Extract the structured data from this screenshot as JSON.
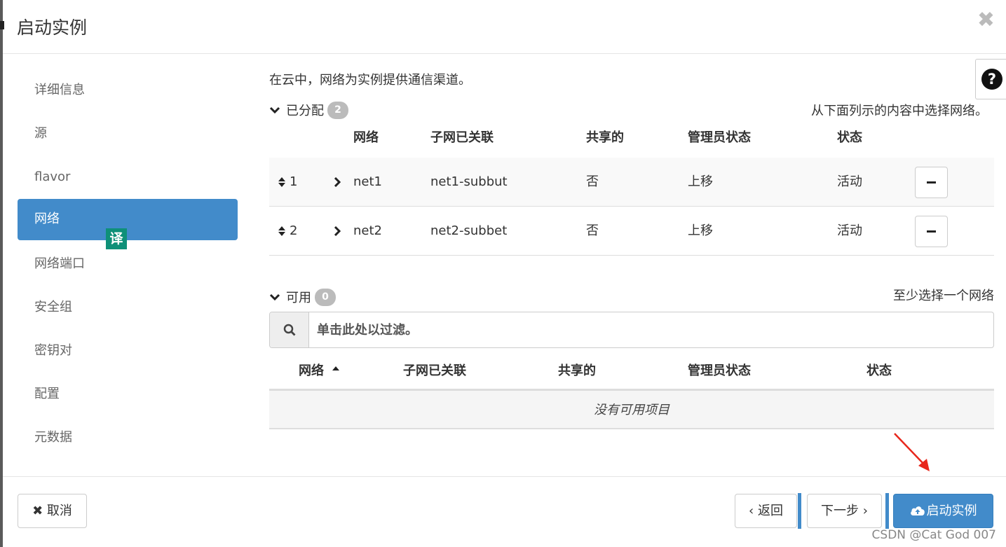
{
  "modal": {
    "title": "启动实例",
    "close_symbol": "✖",
    "help_symbol": "?"
  },
  "sidebar": {
    "items": [
      {
        "label": "详细信息"
      },
      {
        "label": "源"
      },
      {
        "label": "flavor"
      },
      {
        "label": "网络",
        "active": true
      },
      {
        "label": "网络端口"
      },
      {
        "label": "安全组"
      },
      {
        "label": "密钥对"
      },
      {
        "label": "配置"
      },
      {
        "label": "元数据"
      }
    ],
    "translate_badge": "译"
  },
  "main": {
    "intro": "在云中，网络为实例提供通信渠道。",
    "allocated": {
      "title": "已分配",
      "count": "2",
      "hint": "从下面列示的内容中选择网络。",
      "columns": [
        "网络",
        "子网已关联",
        "共享的",
        "管理员状态",
        "状态"
      ],
      "rows": [
        {
          "index": "1",
          "network": "net1",
          "subnet": "net1-subbut",
          "shared": "否",
          "admin_state": "上移",
          "status": "活动"
        },
        {
          "index": "2",
          "network": "net2",
          "subnet": "net2-subbet",
          "shared": "否",
          "admin_state": "上移",
          "status": "活动"
        }
      ]
    },
    "available": {
      "title": "可用",
      "count": "0",
      "hint": "至少选择一个网络",
      "filter_placeholder": "单击此处以过滤。",
      "columns": [
        "网络",
        "子网已关联",
        "共享的",
        "管理员状态",
        "状态"
      ],
      "empty_text": "没有可用项目"
    }
  },
  "footer": {
    "cancel_label": "✖ 取消",
    "back_label": "‹ 返回",
    "next_label": "下一步 ›",
    "launch_label": "启动实例"
  },
  "watermark": "CSDN @Cat God 007",
  "colors": {
    "primary": "#428bca",
    "badge_grey": "#bbbbbb",
    "translate_green": "#0e9078",
    "annotation_arrow": "#e8271c"
  }
}
